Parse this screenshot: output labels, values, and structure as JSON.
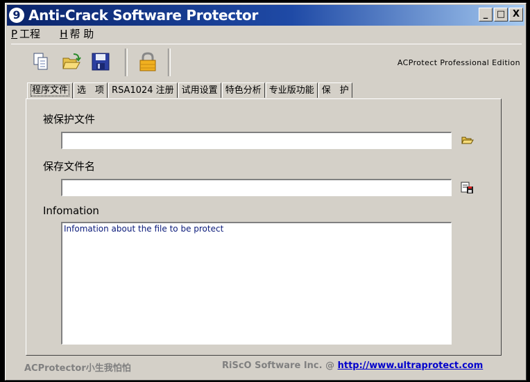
{
  "window": {
    "title": "Anti-Crack Software Protector",
    "app_icon_glyph": "9"
  },
  "titlebar_buttons": {
    "minimize": "_",
    "maximize": "□",
    "close": "X"
  },
  "menu": [
    {
      "key": "P",
      "label": "工程"
    },
    {
      "key": "H",
      "label": "帮 助"
    }
  ],
  "toolbar": {
    "icons": [
      "copy-icon",
      "open-folder-icon",
      "save-icon",
      "lock-icon"
    ],
    "edition": "ACProtect  Professional Edition"
  },
  "tabs": [
    "程序文件",
    "选　项",
    "RSA1024 注册",
    "试用设置",
    "特色分析",
    "专业版功能",
    "保　护"
  ],
  "form": {
    "protected_file_label": "被保护文件",
    "protected_file_value": "",
    "save_file_label": "保存文件名",
    "save_file_value": "",
    "info_label": "Infomation",
    "info_text": "Infomation about the file to be protect"
  },
  "footer": {
    "left": "ACProtector小生我怕怕",
    "company": "RiScO Software Inc.  @ ",
    "link": "http://www.ultraprotect.com"
  },
  "colors": {
    "title_start": "#0a246a",
    "title_end": "#a6caf0",
    "face": "#d4d0c8",
    "info_text": "#0a1a7a",
    "link": "#0000cc"
  }
}
